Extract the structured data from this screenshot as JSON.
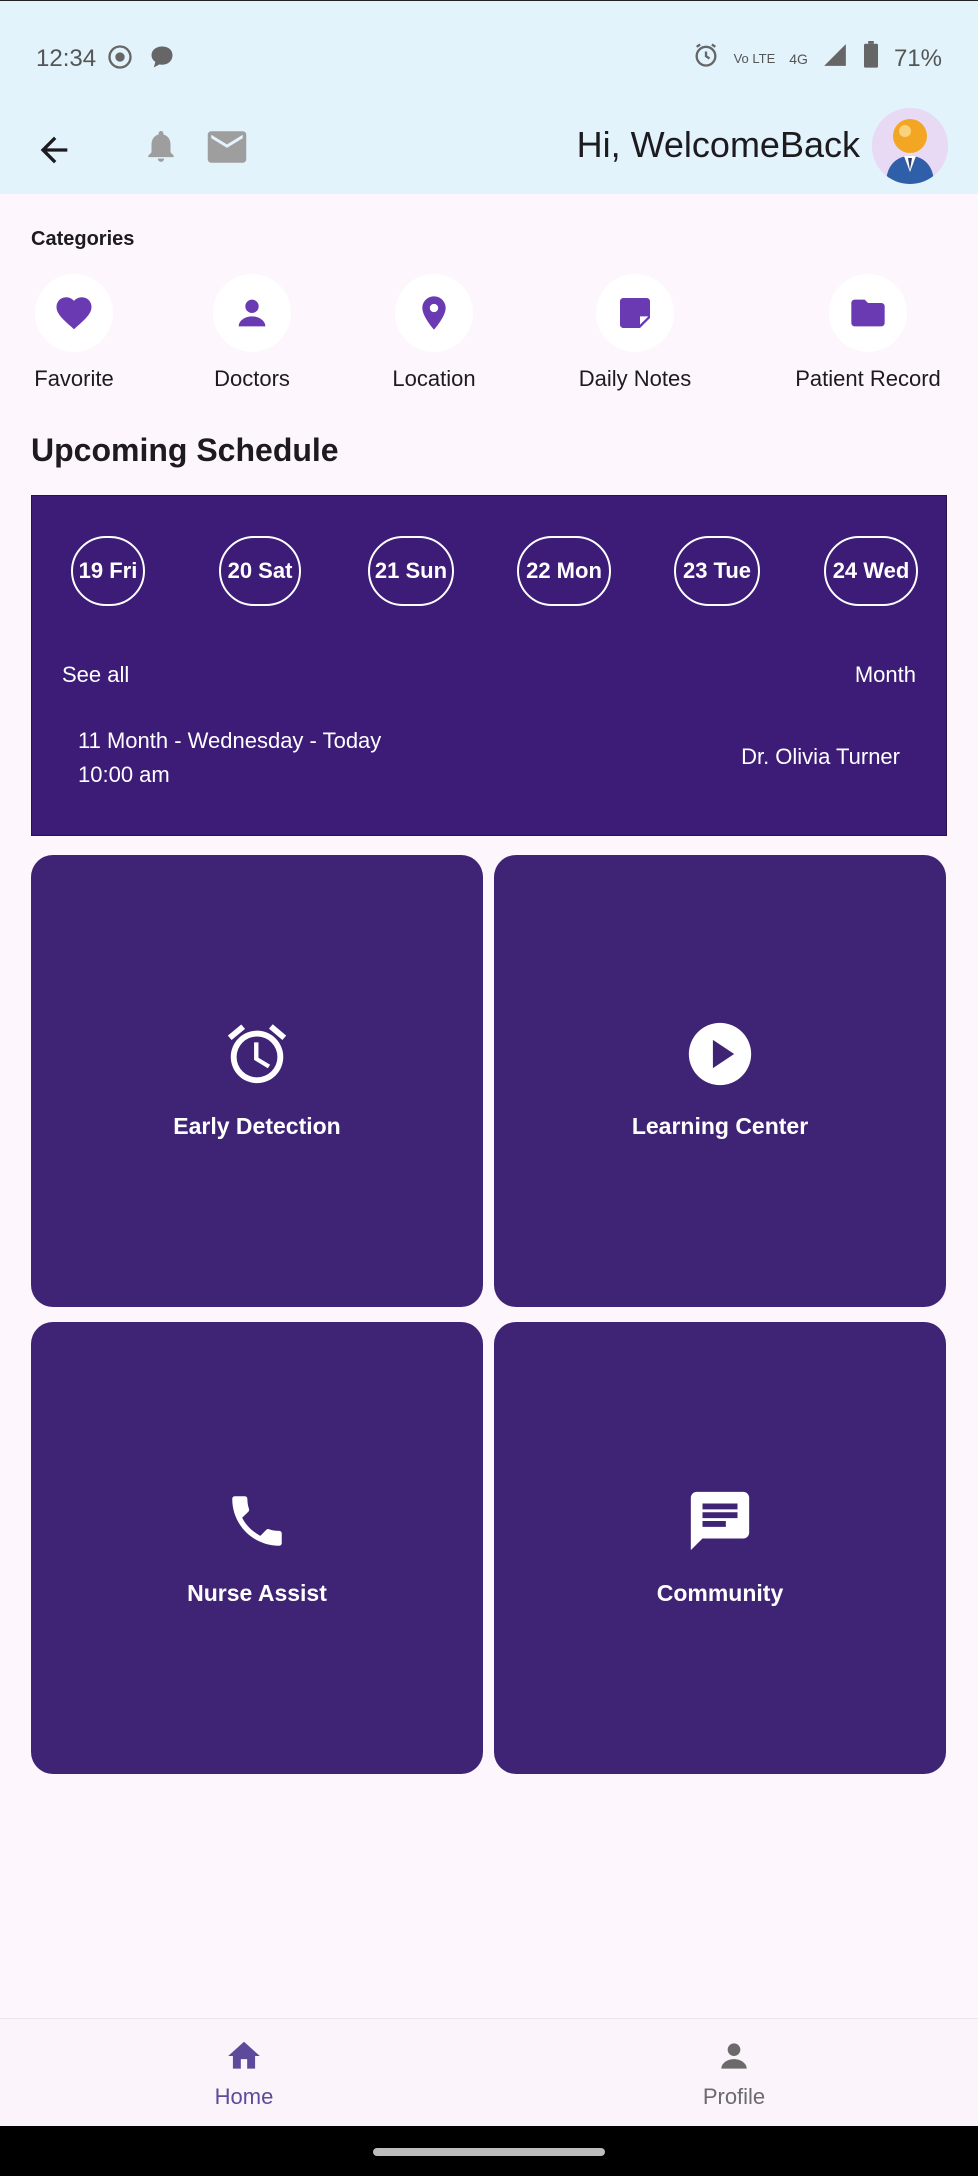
{
  "status_bar": {
    "time": "12:34",
    "battery": "71%",
    "network": "4G",
    "lte": "Vo LTE"
  },
  "header": {
    "greeting": "Hi, WelcomeBack"
  },
  "categories": {
    "title": "Categories",
    "items": [
      {
        "label": "Favorite",
        "icon": "heart-icon"
      },
      {
        "label": "Doctors",
        "icon": "person-icon"
      },
      {
        "label": "Location",
        "icon": "location-pin-icon"
      },
      {
        "label": "Daily Notes",
        "icon": "note-icon"
      },
      {
        "label": "Patient Record",
        "icon": "folder-icon"
      }
    ]
  },
  "schedule": {
    "title": "Upcoming Schedule",
    "days": [
      "19 Fri",
      "20 Sat",
      "21 Sun",
      "22 Mon",
      "23 Tue",
      "24 Wed"
    ],
    "see_all": "See all",
    "month": "Month",
    "appointment": {
      "date": "11 Month - Wednesday - Today",
      "time": "10:00 am",
      "doctor": "Dr. Olivia Turner"
    }
  },
  "tiles": [
    {
      "label": "Early Detection",
      "icon": "alarm-icon"
    },
    {
      "label": "Learning Center",
      "icon": "play-icon"
    },
    {
      "label": "Nurse Assist",
      "icon": "phone-icon"
    },
    {
      "label": "Community",
      "icon": "chat-icon"
    }
  ],
  "bottom_nav": {
    "home": "Home",
    "profile": "Profile"
  },
  "colors": {
    "accent": "#6a3ab2",
    "card": "#3f2476",
    "schedule_bg": "#3d1c78",
    "header_bg": "#e2f3fb"
  }
}
